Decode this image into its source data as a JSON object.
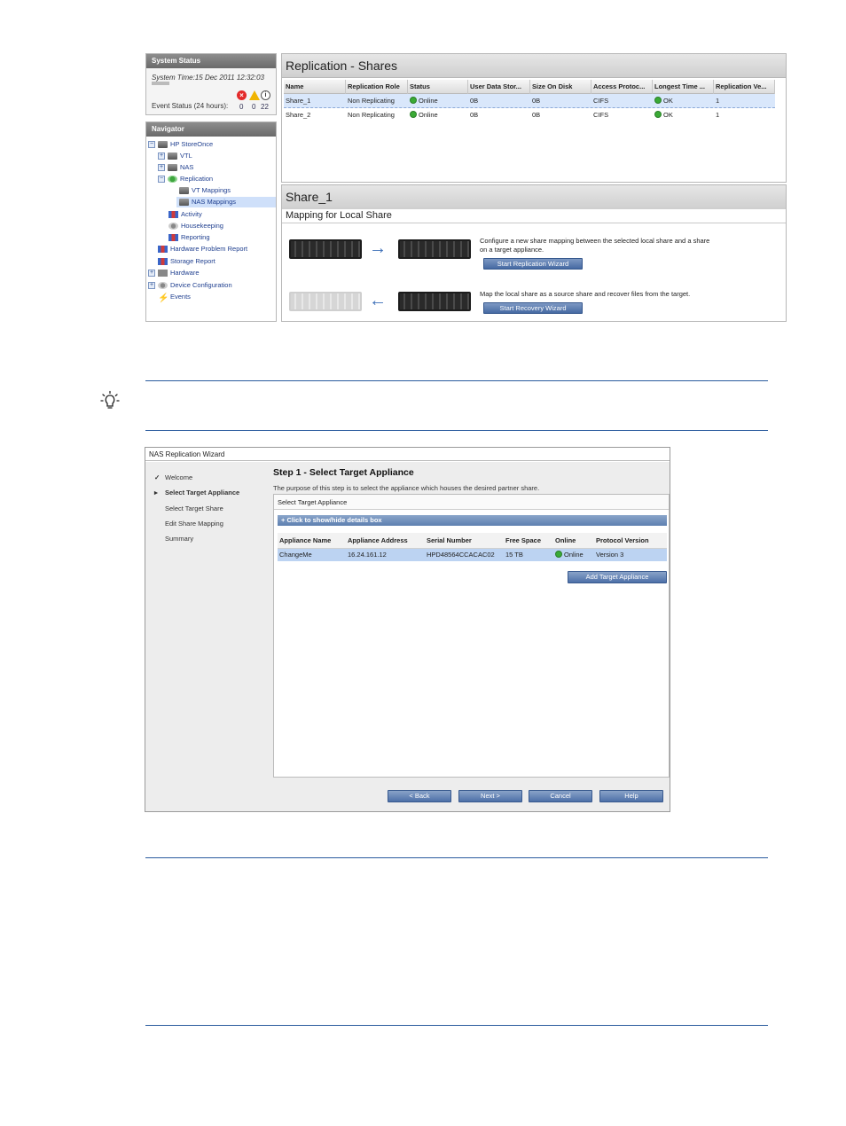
{
  "screenshot1": {
    "system_status": {
      "header": "System Status",
      "system_time": "System Time:15 Dec 2011 12:32:03",
      "event_status_label": "Event Status (24 hours):",
      "errors": "0",
      "warnings": "0",
      "info": "22"
    },
    "navigator": {
      "header": "Navigator",
      "items": [
        {
          "label": "HP StoreOnce",
          "expander": "−",
          "icon": "server-icon"
        },
        {
          "label": "VTL",
          "expander": "+",
          "icon": "server-icon"
        },
        {
          "label": "NAS",
          "expander": "+",
          "icon": "server-icon"
        },
        {
          "label": "Replication",
          "expander": "−",
          "icon": "replication-icon"
        },
        {
          "label": "VT Mappings",
          "expander": "",
          "icon": "server-icon"
        },
        {
          "label": "NAS Mappings",
          "expander": "",
          "icon": "server-icon"
        },
        {
          "label": "Activity",
          "expander": "",
          "icon": "chart-icon"
        },
        {
          "label": "Housekeeping",
          "expander": "",
          "icon": "gear-icon"
        },
        {
          "label": "Reporting",
          "expander": "",
          "icon": "chart-icon"
        },
        {
          "label": "Hardware Problem Report",
          "expander": "",
          "icon": "chart-icon"
        },
        {
          "label": "Storage Report",
          "expander": "",
          "icon": "chart-icon"
        },
        {
          "label": "Hardware",
          "expander": "+",
          "icon": "hardware-icon"
        },
        {
          "label": "Device Configuration",
          "expander": "+",
          "icon": "gear-icon"
        },
        {
          "label": "Events",
          "expander": "",
          "icon": "bolt-icon"
        }
      ]
    },
    "shares_panel": {
      "title": "Replication - Shares",
      "columns": [
        "Name",
        "Replication Role",
        "Status",
        "User Data Stor...",
        "Size On Disk",
        "Access Protoc...",
        "Longest Time ...",
        "Replication Ve..."
      ],
      "rows": [
        [
          "Share_1",
          "Non Replicating",
          "Online",
          "0B",
          "0B",
          "CIFS",
          "OK",
          "1"
        ],
        [
          "Share_2",
          "Non Replicating",
          "Online",
          "0B",
          "0B",
          "CIFS",
          "OK",
          "1"
        ]
      ]
    },
    "share_detail": {
      "title": "Share_1",
      "subtitle": "Mapping for Local Share",
      "configure_text_1": "Configure a new share mapping between the selected local share and a share",
      "configure_text_2": "on a target appliance.",
      "start_replication_button": "Start Replication Wizard",
      "recover_text": "Map the local share as a source share and recover files from the target.",
      "start_recovery_button": "Start Recovery Wizard"
    }
  },
  "screenshot2": {
    "window_title": "NAS Replication Wizard",
    "steps": [
      {
        "label": "Welcome",
        "mark": "✓"
      },
      {
        "label": "Select Target Appliance",
        "mark": "▸"
      },
      {
        "label": "Select Target Share",
        "mark": ""
      },
      {
        "label": "Edit Share Mapping",
        "mark": ""
      },
      {
        "label": "Summary",
        "mark": ""
      }
    ],
    "heading": "Step 1 - Select Target Appliance",
    "purpose": "The purpose of this step is to select the appliance which houses the desired partner share.",
    "panel_title": "Select Target Appliance",
    "details_toggle": "+ Click to show/hide details box",
    "columns": [
      "Appliance Name",
      "Appliance Address",
      "Serial Number",
      "Free Space",
      "Online",
      "Protocol Version"
    ],
    "rows": [
      [
        "ChangeMe",
        "16.24.161.12",
        "HPD48564CCACAC02",
        "15 TB",
        "Online",
        "Version 3"
      ]
    ],
    "add_button": "Add Target Appliance",
    "buttons": {
      "back": "< Back",
      "next": "Next >",
      "cancel": "Cancel",
      "help": "Help"
    }
  },
  "colors": {
    "rule_blue": "#2a5b9e",
    "button_blue": "#4d70a8",
    "selection_blue": "#bcd3f2",
    "ok_green": "#3aaa35",
    "error_red": "#e32a2a",
    "warning_yellow": "#f0b400"
  }
}
